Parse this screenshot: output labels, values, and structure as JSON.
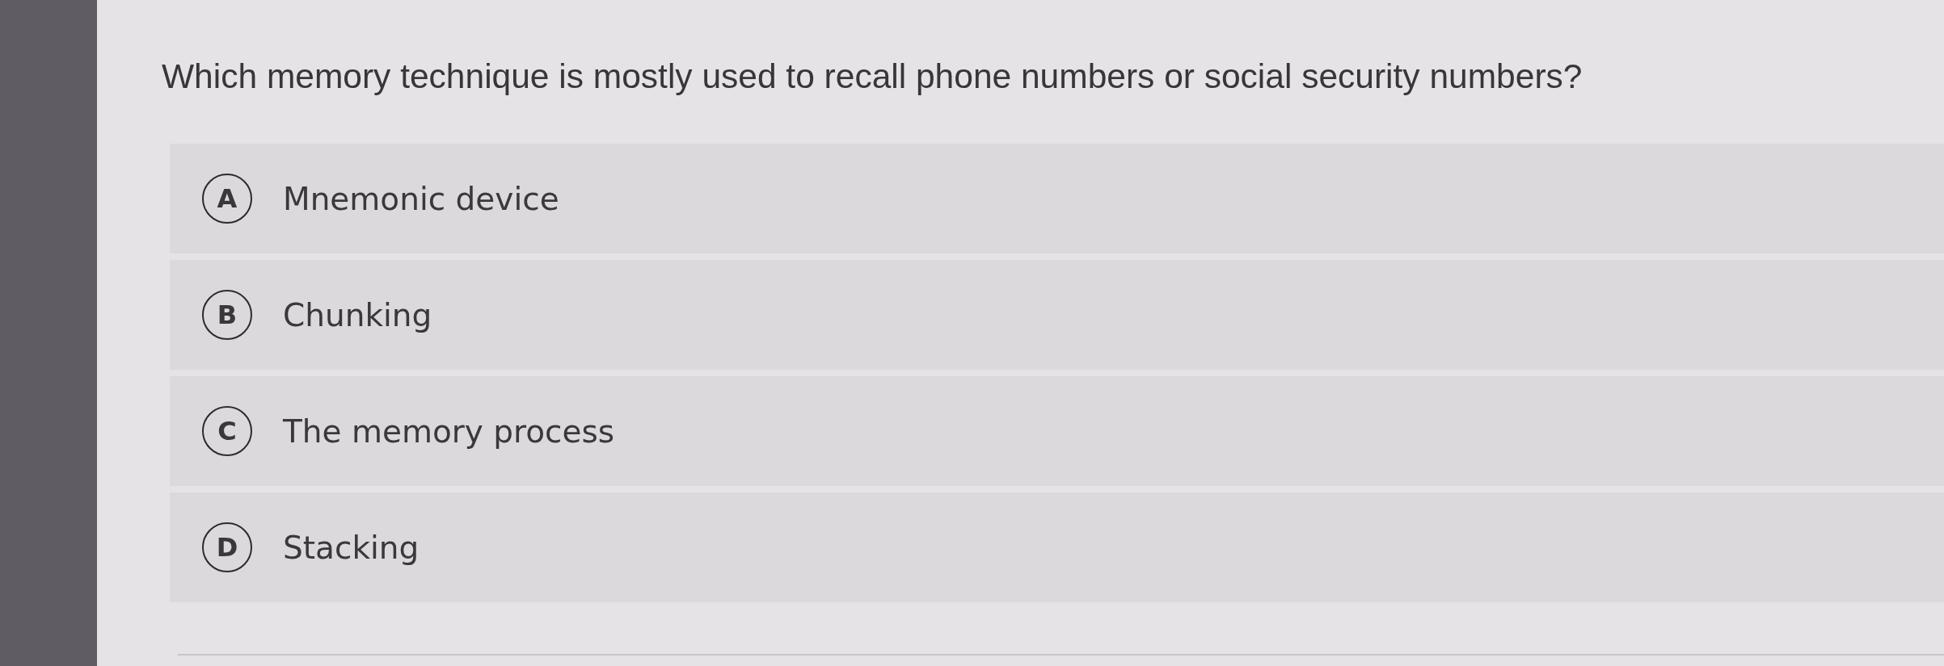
{
  "question": {
    "text": "Which memory technique is mostly used to recall phone numbers or social security numbers?"
  },
  "options": [
    {
      "letter": "A",
      "text": "Mnemonic device",
      "selected": false
    },
    {
      "letter": "B",
      "text": "Chunking",
      "selected": false
    },
    {
      "letter": "C",
      "text": "The memory process",
      "selected": false
    },
    {
      "letter": "D",
      "text": "Stacking",
      "selected": false
    }
  ]
}
